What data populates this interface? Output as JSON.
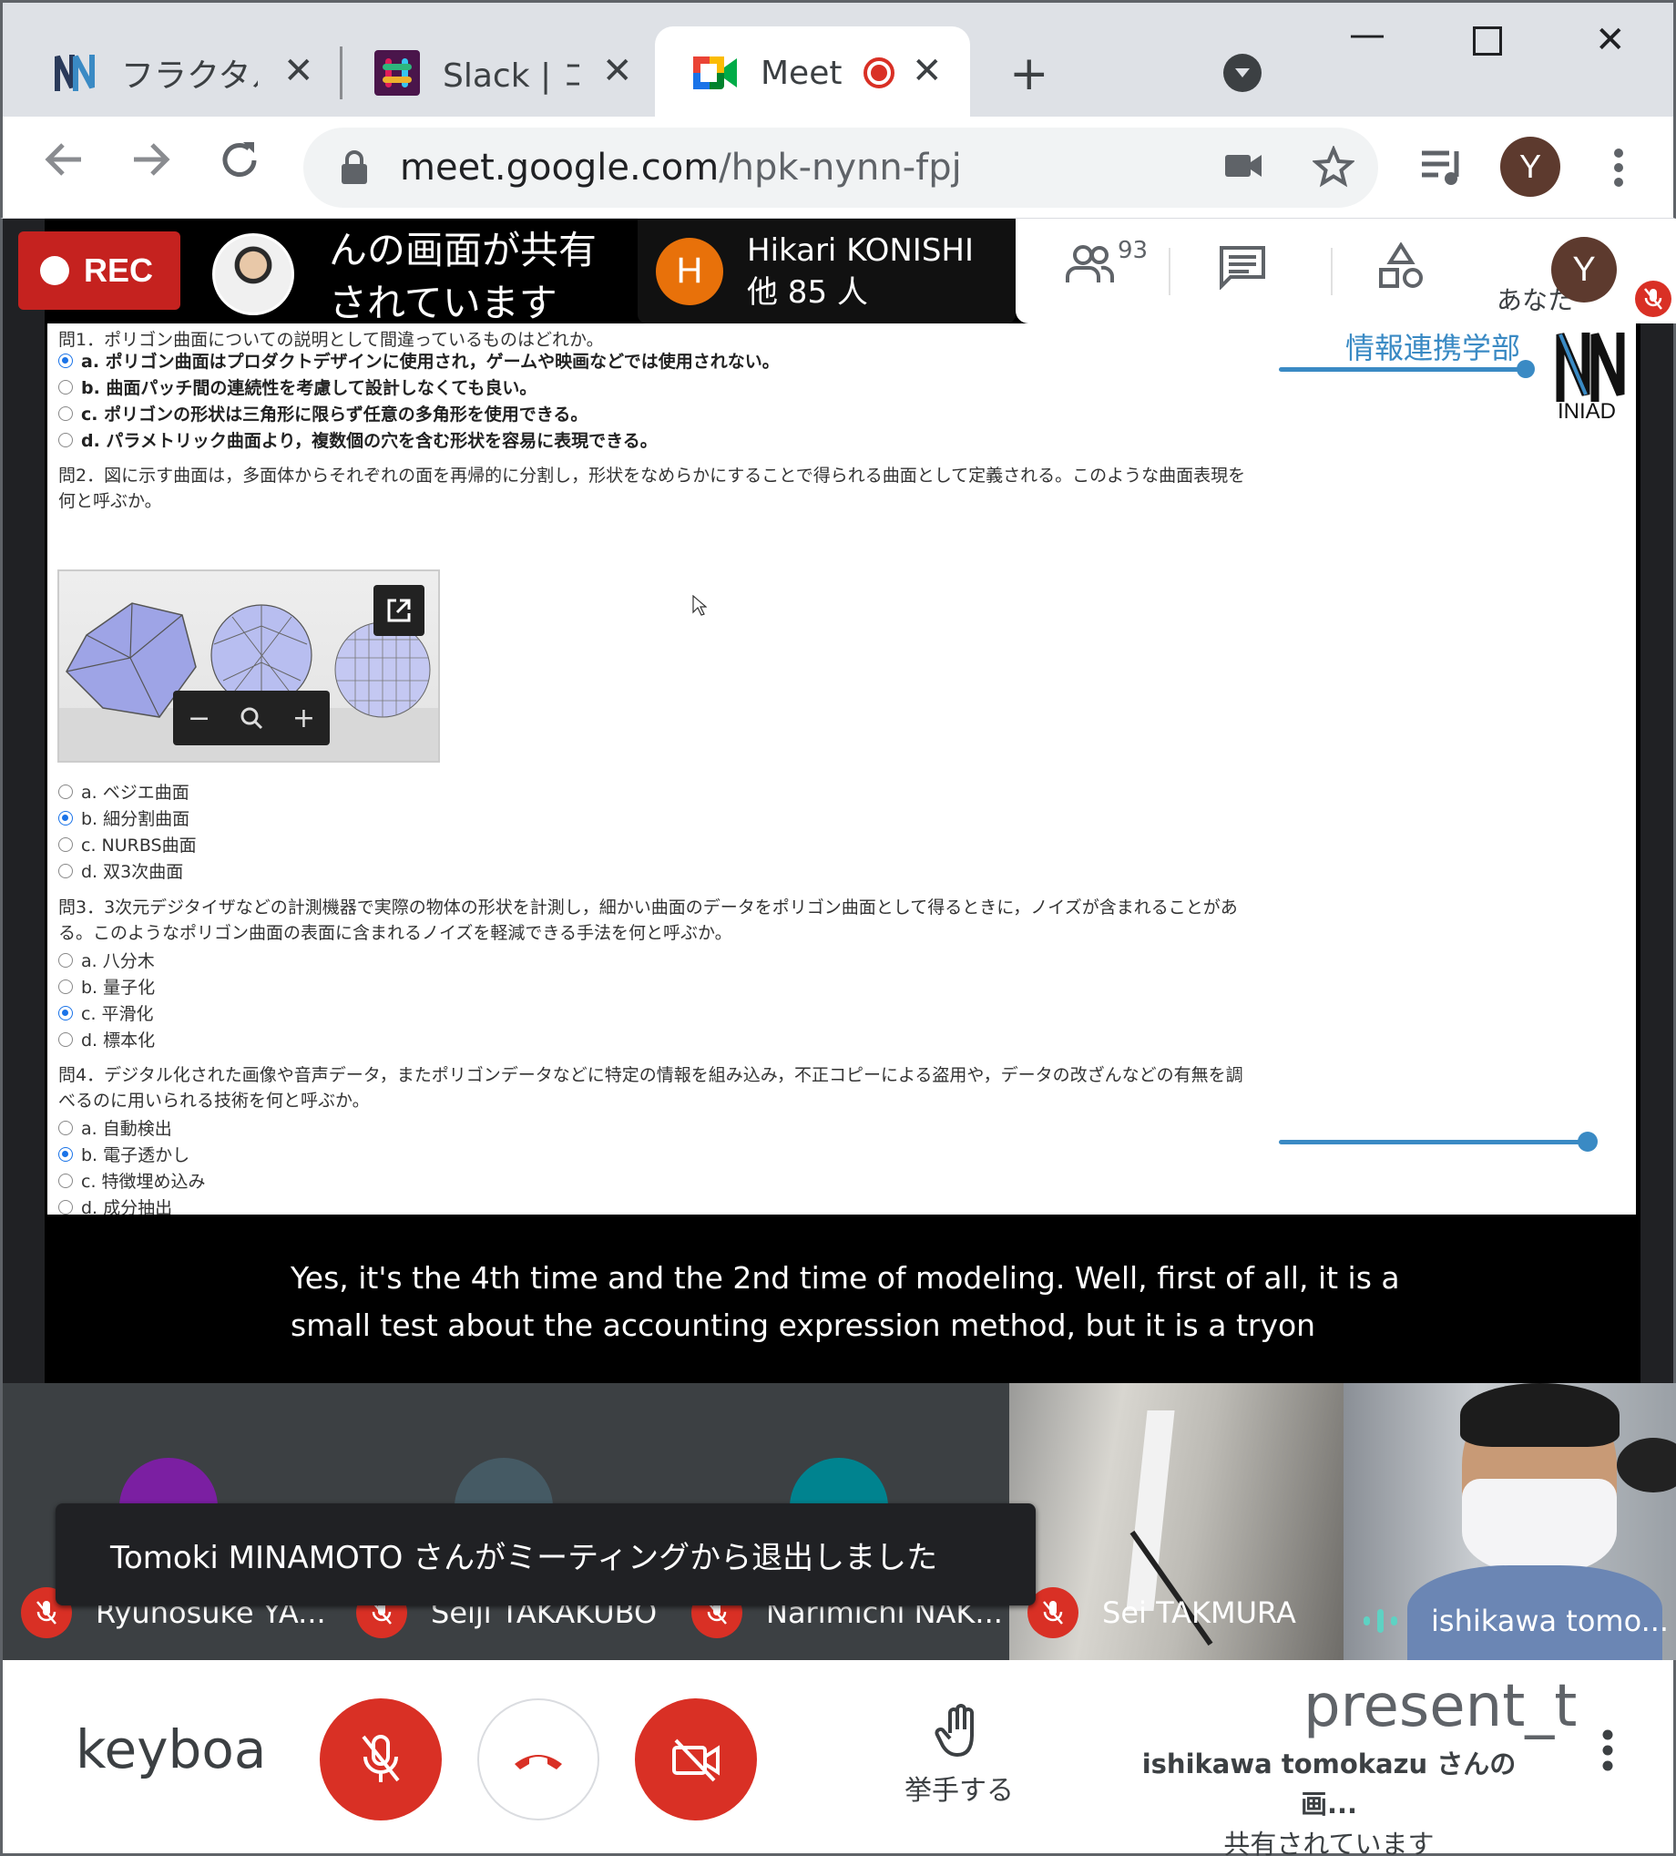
{
  "browser": {
    "tabs": [
      {
        "title": "フラクタル(",
        "icon": "iniad-icon",
        "active": false
      },
      {
        "title": "Slack | コン",
        "icon": "slack-icon",
        "active": false
      },
      {
        "title": "Meet",
        "icon": "meet-icon",
        "active": true,
        "recording": true
      }
    ],
    "url_host": "meet.google.com",
    "url_path": "/hpk-nynn-fpj",
    "profile_initial": "Y"
  },
  "meet": {
    "rec_label": "REC",
    "presenter_text": "んの画面が共有されています",
    "host_initial": "H",
    "host_name": "Hikari KONISHI",
    "others": "他 85 人",
    "participant_count": "93",
    "you_label": "あなた",
    "you_initial": "Y",
    "captions": "Yes, it's the 4th time and the 2nd time of modeling. Well, first of all, it is a small test about the accounting expression method, but it is a tryon",
    "toast": "Tomoki MINAMOTO さんがミーティングから退出しました",
    "participants": [
      {
        "name": "Ryunosuke YA...",
        "muted": true,
        "color": "#7b1fa2"
      },
      {
        "name": "Seiji TAKAKUBO",
        "muted": true,
        "color": "#455a64"
      },
      {
        "name": "Narimichi NAK...",
        "muted": true,
        "color": "#00838f"
      },
      {
        "name": "Sei TAKMURA",
        "muted": true
      },
      {
        "name": "ishikawa tomo...",
        "muted": false,
        "speaking": true
      }
    ],
    "controls": {
      "keyboard_text": "keyboai",
      "raise_hand_label": "挙手する",
      "present_text": "present_t",
      "presenting_name": "ishikawa tomokazu さんの画...",
      "presenting_status": "共有されています"
    }
  },
  "slide": {
    "dept_label": "情報連携学部",
    "logo_text": "INIAD",
    "q1": {
      "text": "問1．ポリゴン曲面についての説明として間違っているものはどれか。",
      "options": [
        {
          "label": "a. ポリゴン曲面はプロダクトデザインに使用され，ゲームや映画などでは使用されない。",
          "selected": true
        },
        {
          "label": "b. 曲面パッチ間の連続性を考慮して設計しなくても良い。",
          "selected": false
        },
        {
          "label": "c. ポリゴンの形状は三角形に限らず任意の多角形を使用できる。",
          "selected": false
        },
        {
          "label": "d. パラメトリック曲面より，複数個の穴を含む形状を容易に表現できる。",
          "selected": false
        }
      ]
    },
    "q2": {
      "line1": "問2．図に示す曲面は，多面体からそれぞれの面を再帰的に分割し，形状をなめらかにすることで得られる曲面として定義される。このような曲面表現を",
      "line2": "何と呼ぶか。",
      "options": [
        {
          "label": "a. ベジエ曲面",
          "selected": false
        },
        {
          "label": "b. 細分割曲面",
          "selected": true
        },
        {
          "label": "c. NURBS曲面",
          "selected": false
        },
        {
          "label": "d. 双3次曲面",
          "selected": false
        }
      ]
    },
    "q3": {
      "line1": "問3．3次元デジタイザなどの計測機器で実際の物体の形状を計測し，細かい曲面のデータをポリゴン曲面として得るときに，ノイズが含まれることがあ",
      "line2": "る。このようなポリゴン曲面の表面に含まれるノイズを軽減できる手法を何と呼ぶか。",
      "options": [
        {
          "label": "a. 八分木",
          "selected": false
        },
        {
          "label": "b. 量子化",
          "selected": false
        },
        {
          "label": "c. 平滑化",
          "selected": true
        },
        {
          "label": "d. 標本化",
          "selected": false
        }
      ]
    },
    "q4": {
      "line1": "問4．デジタル化された画像や音声データ，またポリゴンデータなどに特定の情報を組み込み，不正コピーによる盗用や，データの改ざんなどの有無を調",
      "line2": "べるのに用いられる技術を何と呼ぶか。",
      "options": [
        {
          "label": "a. 自動検出",
          "selected": false
        },
        {
          "label": "b. 電子透かし",
          "selected": true
        },
        {
          "label": "c. 特徴埋め込み",
          "selected": false
        },
        {
          "label": "d. 成分抽出",
          "selected": false
        }
      ]
    }
  }
}
